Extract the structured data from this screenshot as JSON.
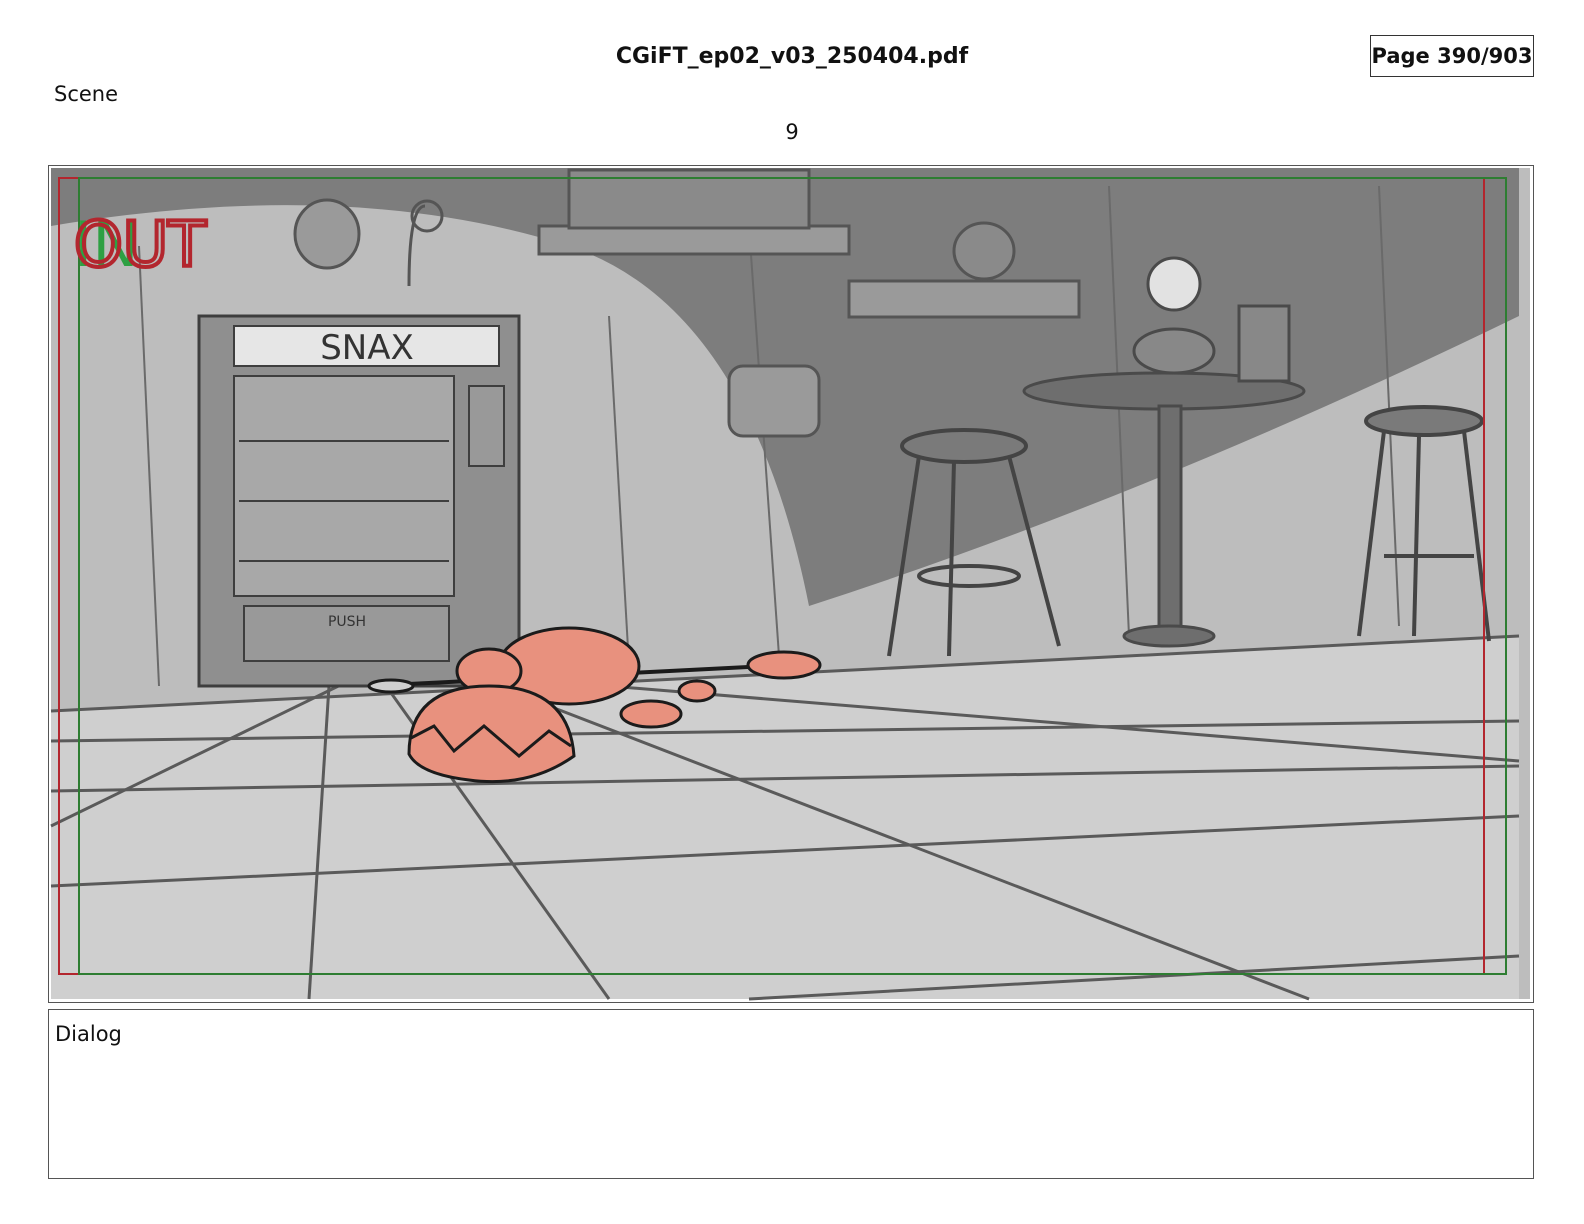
{
  "header": {
    "file_title": "CGiFT_ep02_v03_250404.pdf",
    "page_indicator": "Page 390/903"
  },
  "scene": {
    "label": "Scene",
    "number": "9"
  },
  "panel": {
    "out_marker": "OUT",
    "in_marker": "IN",
    "vending_sign": "SNAX",
    "vending_push": "PUSH"
  },
  "dialog": {
    "label": "Dialog"
  },
  "colors": {
    "safe_red": "#b3262e",
    "safe_green": "#2e7d32",
    "character_fill": "#e8917e"
  }
}
